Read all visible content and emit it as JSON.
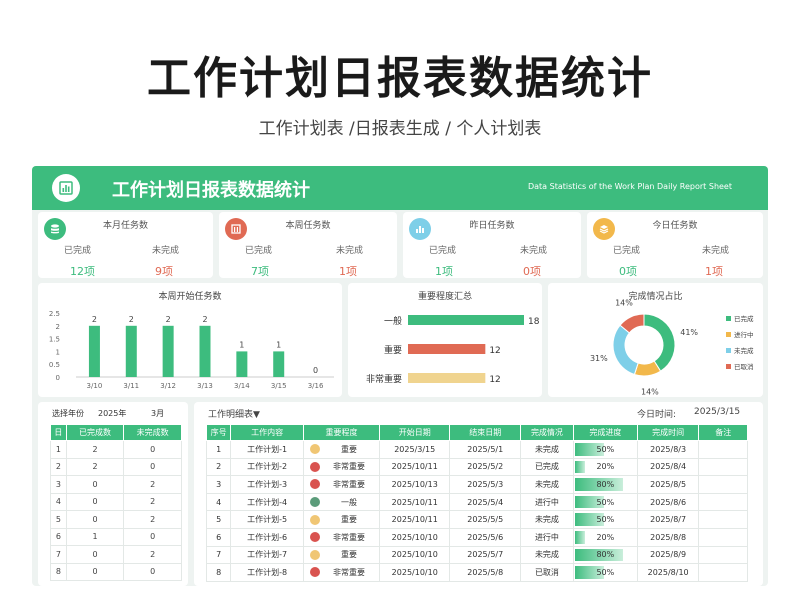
{
  "page": {
    "title": "工作计划日报表数据统计",
    "subtitle": "工作计划表 /日报表生成 / 个人计划表"
  },
  "banner": {
    "title": "工作计划日报表数据统计",
    "en_title": "Data Statistics of the Work Plan Daily Report Sheet"
  },
  "kpis": [
    {
      "title": "本月任务数",
      "label_done": "已完成",
      "label_undone": "未完成",
      "done": "12项",
      "undone": "9项",
      "icon": "database-icon",
      "color": "#3dbc7e"
    },
    {
      "title": "本周任务数",
      "label_done": "已完成",
      "label_undone": "未完成",
      "done": "7项",
      "undone": "1项",
      "icon": "building-icon",
      "color": "#e06a54"
    },
    {
      "title": "昨日任务数",
      "label_done": "已完成",
      "label_undone": "未完成",
      "done": "1项",
      "undone": "0项",
      "icon": "bar-chart-icon",
      "color": "#7ecfe8"
    },
    {
      "title": "今日任务数",
      "label_done": "已完成",
      "label_undone": "未完成",
      "done": "0项",
      "undone": "1项",
      "icon": "stack-icon",
      "color": "#f2b84b"
    }
  ],
  "colors": {
    "green": "#3dbc7e",
    "red": "#e06a54",
    "blue": "#7ecfe8",
    "yellow": "#f0d48f",
    "orange": "#f2b84b"
  },
  "chart_data": [
    {
      "type": "bar",
      "title": "本周开始任务数",
      "categories": [
        "3/10",
        "3/11",
        "3/12",
        "3/13",
        "3/14",
        "3/15",
        "3/16"
      ],
      "values": [
        2,
        2,
        2,
        2,
        1,
        1,
        0
      ],
      "ylim": [
        0,
        2.5
      ],
      "yticks": [
        "0",
        "0.5",
        "1",
        "1.5",
        "2",
        "2.5"
      ],
      "grid": false
    },
    {
      "type": "bar",
      "orientation": "horizontal",
      "title": "重要程度汇总",
      "categories": [
        "一般",
        "重要",
        "非常重要"
      ],
      "values": [
        18,
        12,
        12
      ],
      "xlim": [
        0,
        18
      ]
    },
    {
      "type": "pie",
      "donut": true,
      "title": "完成情况占比",
      "labels": [
        "已完成",
        "进行中",
        "未完成",
        "已取消"
      ],
      "values": [
        41,
        14,
        31,
        14
      ],
      "value_labels": [
        "41%",
        "14%",
        "31%",
        "14%"
      ],
      "legend": "right"
    }
  ],
  "selector": {
    "year_label": "选择年份",
    "year": "2025年",
    "month": "3月",
    "headers": [
      "日",
      "已完成数",
      "未完成数"
    ],
    "rows": [
      [
        "1",
        "2",
        "0"
      ],
      [
        "2",
        "2",
        "0"
      ],
      [
        "3",
        "0",
        "2"
      ],
      [
        "4",
        "0",
        "2"
      ],
      [
        "5",
        "0",
        "2"
      ],
      [
        "6",
        "1",
        "0"
      ],
      [
        "7",
        "0",
        "2"
      ],
      [
        "8",
        "0",
        "0"
      ]
    ]
  },
  "detail": {
    "title": "工作明细表▼",
    "today_label": "今日时间:",
    "today": "2025/3/15",
    "headers": [
      "序号",
      "工作内容",
      "重要程度",
      "开始日期",
      "结束日期",
      "完成情况",
      "完成进度",
      "完成时间",
      "备注"
    ],
    "rows": [
      {
        "no": "1",
        "task": "工作计划-1",
        "dot": "#f0c674",
        "level": "重要",
        "start": "2025/3/15",
        "end": "2025/5/1",
        "status": "未完成",
        "progress": "50%",
        "pct": 0.5,
        "done": "2025/8/3",
        "note": ""
      },
      {
        "no": "2",
        "task": "工作计划-2",
        "dot": "#d9534f",
        "level": "非常重要",
        "start": "2025/10/11",
        "end": "2025/5/2",
        "status": "已完成",
        "progress": "20%",
        "pct": 0.2,
        "done": "2025/8/4",
        "note": ""
      },
      {
        "no": "3",
        "task": "工作计划-3",
        "dot": "#d9534f",
        "level": "非常重要",
        "start": "2025/10/13",
        "end": "2025/5/3",
        "status": "未完成",
        "progress": "80%",
        "pct": 0.8,
        "done": "2025/8/5",
        "note": ""
      },
      {
        "no": "4",
        "task": "工作计划-4",
        "dot": "#5b9c7a",
        "level": "一般",
        "start": "2025/10/11",
        "end": "2025/5/4",
        "status": "进行中",
        "progress": "50%",
        "pct": 0.5,
        "done": "2025/8/6",
        "note": ""
      },
      {
        "no": "5",
        "task": "工作计划-5",
        "dot": "#f0c674",
        "level": "重要",
        "start": "2025/10/11",
        "end": "2025/5/5",
        "status": "未完成",
        "progress": "50%",
        "pct": 0.5,
        "done": "2025/8/7",
        "note": ""
      },
      {
        "no": "6",
        "task": "工作计划-6",
        "dot": "#d9534f",
        "level": "非常重要",
        "start": "2025/10/10",
        "end": "2025/5/6",
        "status": "进行中",
        "progress": "20%",
        "pct": 0.2,
        "done": "2025/8/8",
        "note": ""
      },
      {
        "no": "7",
        "task": "工作计划-7",
        "dot": "#f0c674",
        "level": "重要",
        "start": "2025/10/10",
        "end": "2025/5/7",
        "status": "未完成",
        "progress": "80%",
        "pct": 0.8,
        "done": "2025/8/9",
        "note": ""
      },
      {
        "no": "8",
        "task": "工作计划-8",
        "dot": "#d9534f",
        "level": "非常重要",
        "start": "2025/10/10",
        "end": "2025/5/8",
        "status": "已取消",
        "progress": "50%",
        "pct": 0.5,
        "done": "2025/8/10",
        "note": ""
      }
    ]
  }
}
